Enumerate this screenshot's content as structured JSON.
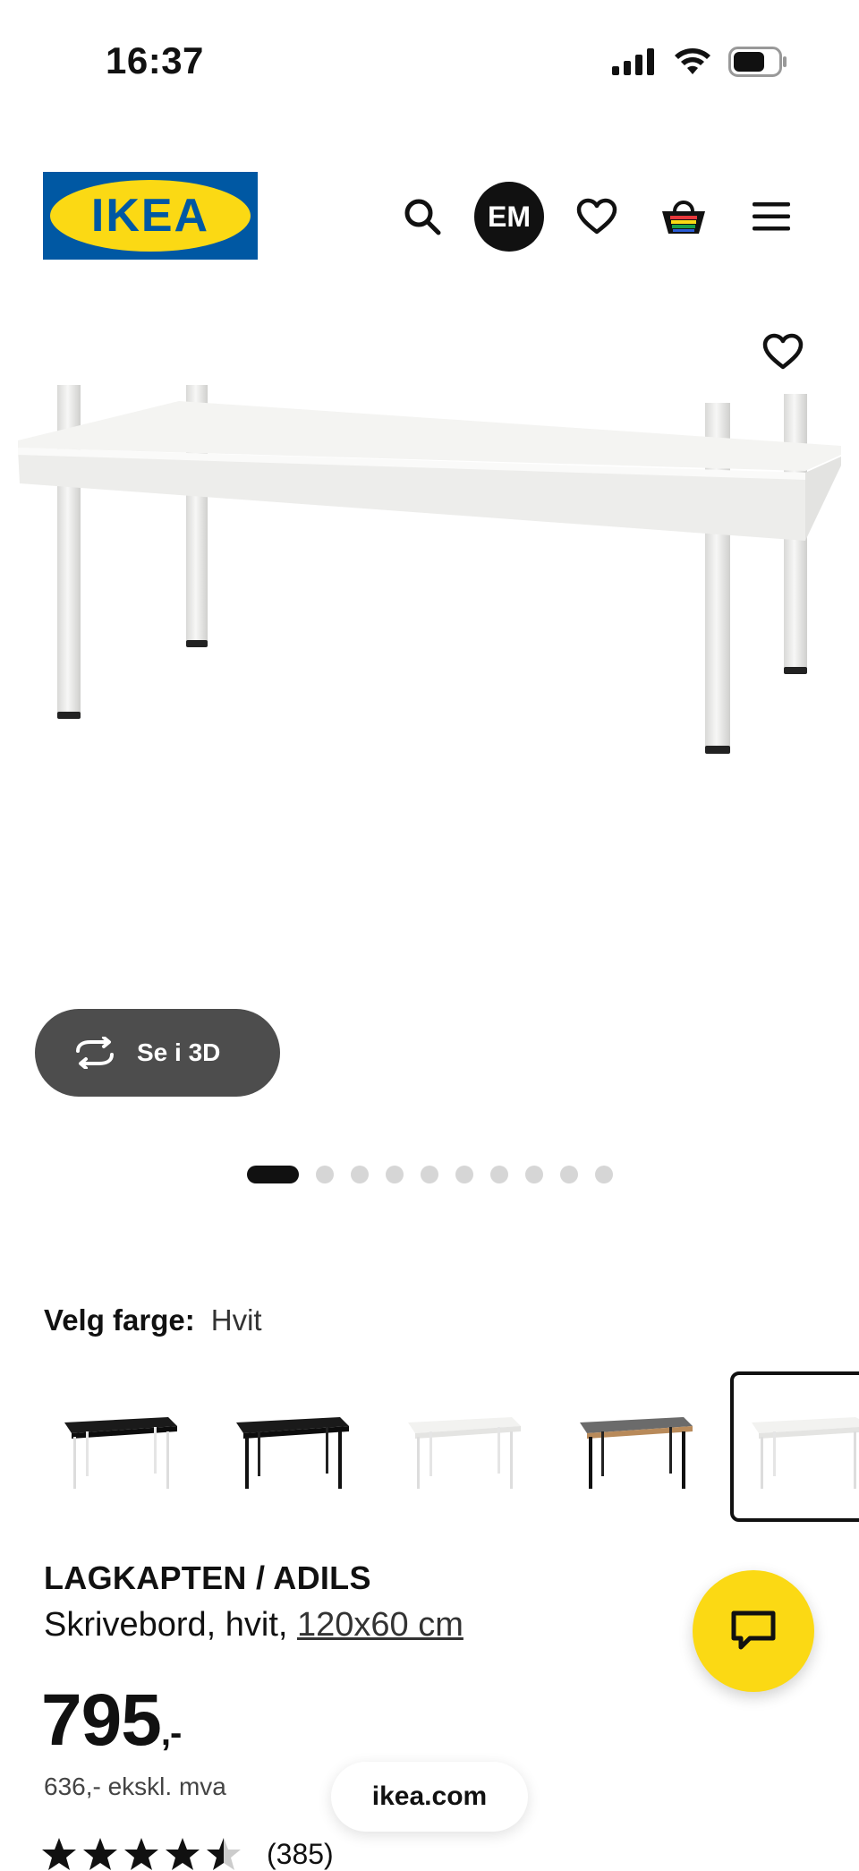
{
  "status_bar": {
    "time": "16:37"
  },
  "header": {
    "logo_text": "IKEA",
    "avatar_initials": "EM",
    "icons": [
      "search-icon",
      "heart-icon",
      "basket-icon",
      "menu-icon"
    ]
  },
  "gallery": {
    "view_3d_label": "Se i 3D",
    "dot_count": 10,
    "active_dot": 0
  },
  "color_picker": {
    "label": "Velg farge:",
    "value": "Hvit",
    "swatches": [
      "black-top-white-legs",
      "black-top-black-legs",
      "white-top-white-legs",
      "grey-top-black-legs",
      "white-top-white-legs-selected"
    ]
  },
  "product": {
    "name": "LAGKAPTEN / ADILS",
    "description": "Skrivebord, hvit, ",
    "size": "120x60 cm",
    "price_main": "795",
    "price_suffix": ",-",
    "price_ex_vat": "636,- ekskl. mva",
    "rating_value": 4.5,
    "rating_count": "(385)"
  },
  "browser": {
    "url_label": "ikea.com"
  },
  "colors": {
    "ikea_blue": "#0058a3",
    "ikea_yellow": "#fbd914",
    "dark": "#111111"
  }
}
